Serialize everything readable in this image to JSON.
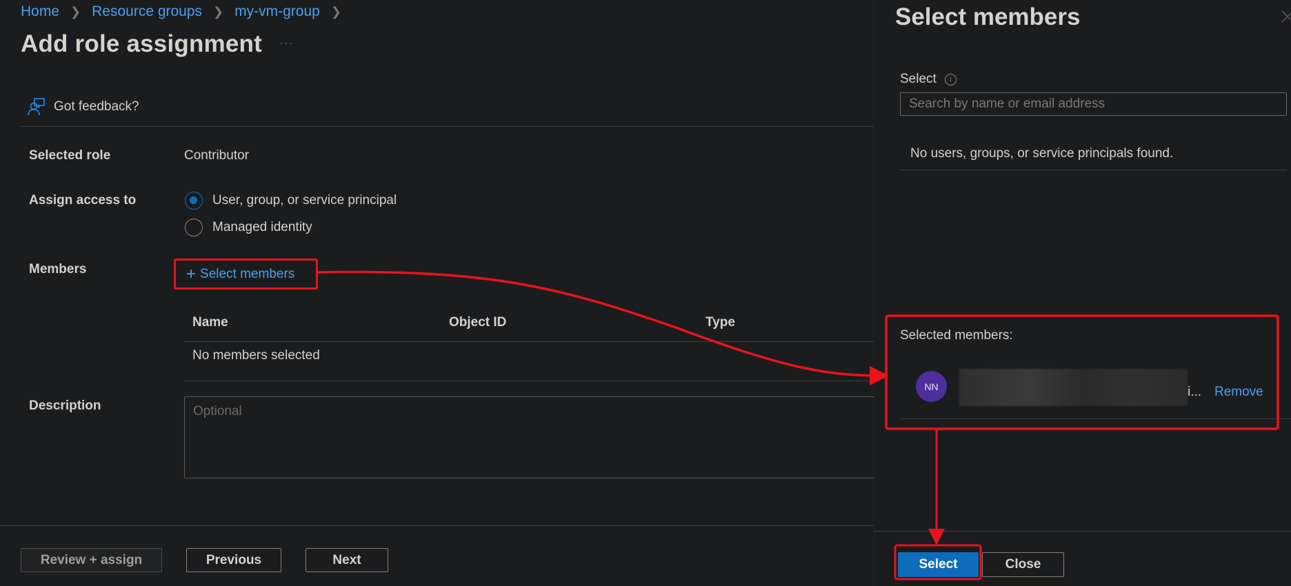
{
  "breadcrumb": [
    {
      "label": "Home"
    },
    {
      "label": "Resource groups"
    },
    {
      "label": "my-vm-group"
    }
  ],
  "page": {
    "title": "Add role assignment",
    "more_icon": "ellipsis-icon"
  },
  "feedback": {
    "label": "Got feedback?",
    "icon": "feedback-icon"
  },
  "form": {
    "selected_role": {
      "label": "Selected role",
      "value": "Contributor"
    },
    "assign_access": {
      "label": "Assign access to",
      "options": [
        {
          "label": "User, group, or service principal",
          "checked": true
        },
        {
          "label": "Managed identity",
          "checked": false
        }
      ]
    },
    "members": {
      "label": "Members",
      "select_link": "Select members",
      "table": {
        "columns": [
          "Name",
          "Object ID",
          "Type"
        ],
        "empty_text": "No members selected"
      }
    },
    "description": {
      "label": "Description",
      "placeholder": "Optional"
    }
  },
  "footer": {
    "review_assign": "Review + assign",
    "previous": "Previous",
    "next": "Next"
  },
  "panel": {
    "title": "Select members",
    "select_label": "Select",
    "search_placeholder": "Search by name or email address",
    "no_results": "No users, groups, or service principals found.",
    "selected_members_label": "Selected members:",
    "selected_members": [
      {
        "initials": "NN",
        "name_tail": "i...",
        "remove_label": "Remove",
        "avatar_color": "#4e2e9b"
      }
    ],
    "select_button": "Select",
    "close_button": "Close"
  },
  "colors": {
    "accent": "#0f6cbd",
    "link": "#4aa0f0",
    "annotation": "#e8141a",
    "background": "#1b1c1e"
  }
}
